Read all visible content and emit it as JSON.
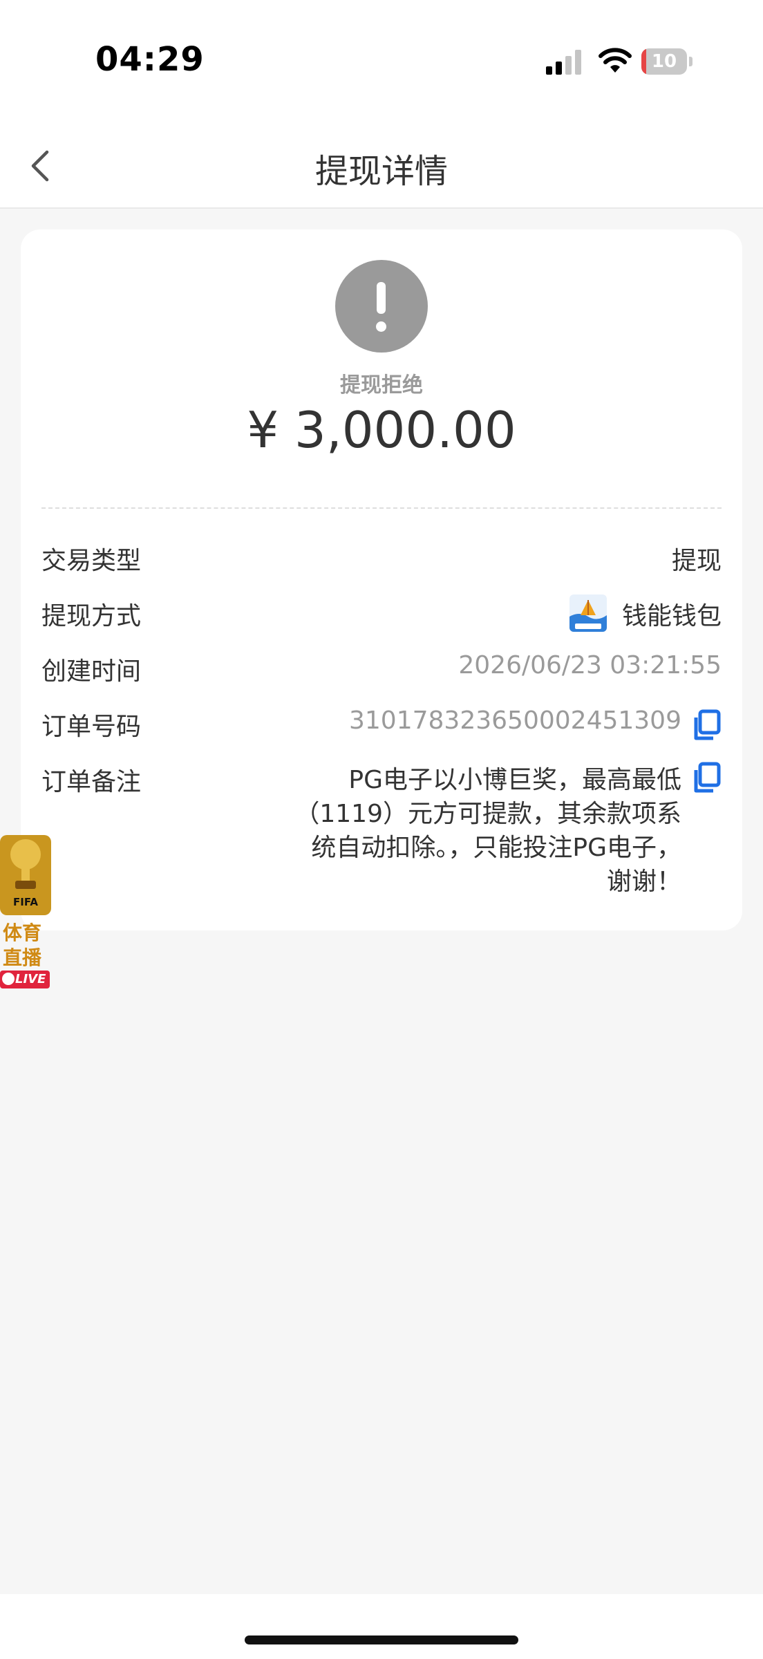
{
  "status_bar": {
    "time": "04:29",
    "battery_level": "10",
    "battery_fraction": 0.1,
    "signal_bars_active": 2,
    "signal_bars_total": 4
  },
  "header": {
    "title": "提现详情",
    "back_icon": "chevron-left-icon"
  },
  "summary": {
    "status_icon": "exclamation-icon",
    "status_text": "提现拒绝",
    "amount": "¥ 3,000.00"
  },
  "details": {
    "type_label": "交易类型",
    "type_value": "提现",
    "method_label": "提现方式",
    "method_value": "钱能钱包",
    "created_label": "创建时间",
    "created_value": "2026/06/23 03:21:55",
    "order_label": "订单号码",
    "order_value": "310178323650002451309",
    "remark_label": "订单备注",
    "remark_value": "PG电子以小博巨奖，最高最低（1119）元方可提款，其余款项系统自动扣除。，只能投注PG电子，谢谢！"
  },
  "float_badge": {
    "fifa_text": "FIFA",
    "line1": "体育",
    "line2": "直播",
    "live_text": "LIVE"
  },
  "colors": {
    "page_bg": "#f6f6f6",
    "card_bg": "#ffffff",
    "status_gray": "#9a9a9a",
    "copy_blue": "#1f6fe5",
    "battery_red": "#e64545",
    "live_red": "#e0243d",
    "gold": "#d08a14"
  }
}
